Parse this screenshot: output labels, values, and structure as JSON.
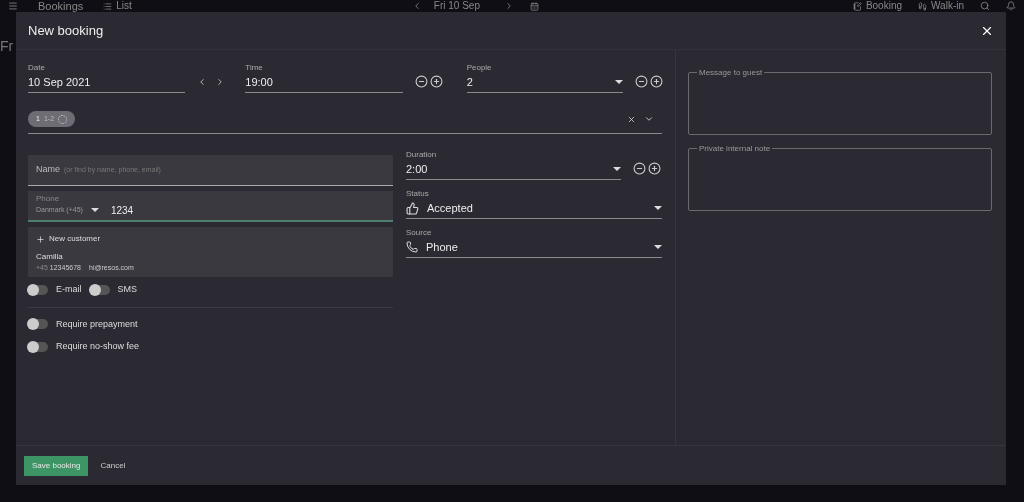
{
  "app_bar": {
    "title": "Bookings",
    "view": "List",
    "date": "Fri 10 Sep",
    "buttons": [
      "Booking",
      "Walk-in"
    ],
    "side_text": "Fr"
  },
  "dialog": {
    "title": "New booking",
    "date": {
      "label": "Date",
      "value": "10 Sep 2021"
    },
    "time": {
      "label": "Time",
      "value": "19:00"
    },
    "people": {
      "label": "People",
      "value": "2"
    },
    "table_chip": {
      "texts": [
        "1",
        "1-2"
      ]
    },
    "name": {
      "label": "Name",
      "placeholder": "(or find by name, phone, email)"
    },
    "phone": {
      "label": "Phone",
      "country": "Danmark (+45)",
      "value": "1234"
    },
    "suggestions": {
      "new_label": "New customer",
      "customers": [
        {
          "name": "Camilla",
          "prefix": "+45",
          "phone": "12345678",
          "email": "hi@resos.com"
        }
      ]
    },
    "notify_toggles": [
      {
        "label": "E-mail",
        "checked": false
      },
      {
        "label": "SMS",
        "checked": false
      }
    ],
    "require_toggles": [
      {
        "label": "Require prepayment",
        "checked": false
      },
      {
        "label": "Require no-show fee",
        "checked": false
      }
    ],
    "duration": {
      "label": "Duration",
      "value": "2:00"
    },
    "status": {
      "label": "Status",
      "value": "Accepted"
    },
    "source": {
      "label": "Source",
      "value": "Phone"
    },
    "message": {
      "label": "Message to guest"
    },
    "note": {
      "label": "Private internal note"
    },
    "save": "Save booking",
    "cancel": "Cancel"
  }
}
